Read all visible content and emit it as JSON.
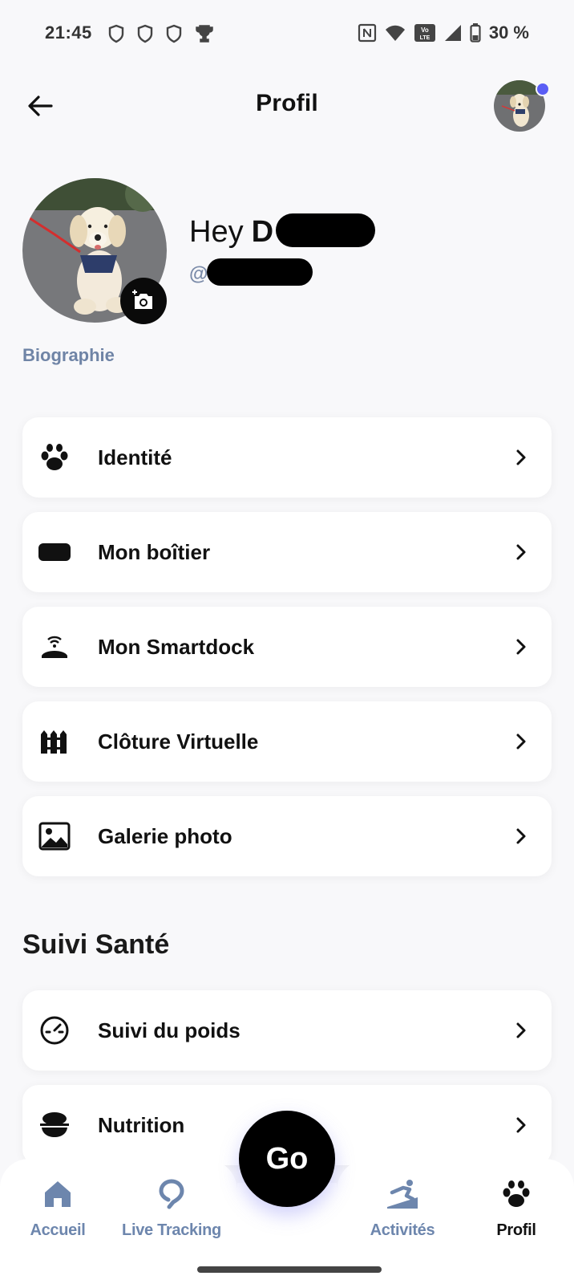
{
  "status_bar": {
    "time": "21:45",
    "battery": "30 %",
    "left_icons": [
      "shield-icon",
      "shield-icon",
      "shield-icon",
      "trophy-icon"
    ],
    "right_icons": [
      "nfc-icon",
      "wifi-icon",
      "volte-icon",
      "signal-icon",
      "battery-icon"
    ]
  },
  "header": {
    "title": "Profil",
    "back_icon": "arrow-left-icon",
    "notification_color": "#5b5ef5"
  },
  "profile": {
    "greeting": "Hey",
    "name_visible": "D",
    "username_prefix": "@",
    "bio_label": "Biographie"
  },
  "menu": [
    {
      "icon": "paw-icon",
      "label": "Identité"
    },
    {
      "icon": "tracker-box-icon",
      "label": "Mon boîtier"
    },
    {
      "icon": "smartdock-icon",
      "label": "Mon Smartdock"
    },
    {
      "icon": "fence-icon",
      "label": "Clôture Virtuelle"
    },
    {
      "icon": "image-icon",
      "label": "Galerie photo"
    }
  ],
  "health_section": {
    "title": "Suivi Santé",
    "items": [
      {
        "icon": "scale-icon",
        "label": "Suivi du poids"
      },
      {
        "icon": "food-bowl-icon",
        "label": "Nutrition"
      }
    ]
  },
  "go_button": {
    "label": "Go"
  },
  "bottom_nav": [
    {
      "icon": "home-icon",
      "label": "Accueil",
      "active": false
    },
    {
      "icon": "location-pin-icon",
      "label": "Live Tracking",
      "active": false
    },
    {
      "icon": "activity-icon",
      "label": "Activités",
      "active": false
    },
    {
      "icon": "paw-icon",
      "label": "Profil",
      "active": true
    }
  ],
  "colors": {
    "accent_blue": "#6d86ad",
    "background": "#f8f8fa",
    "card": "#ffffff"
  }
}
